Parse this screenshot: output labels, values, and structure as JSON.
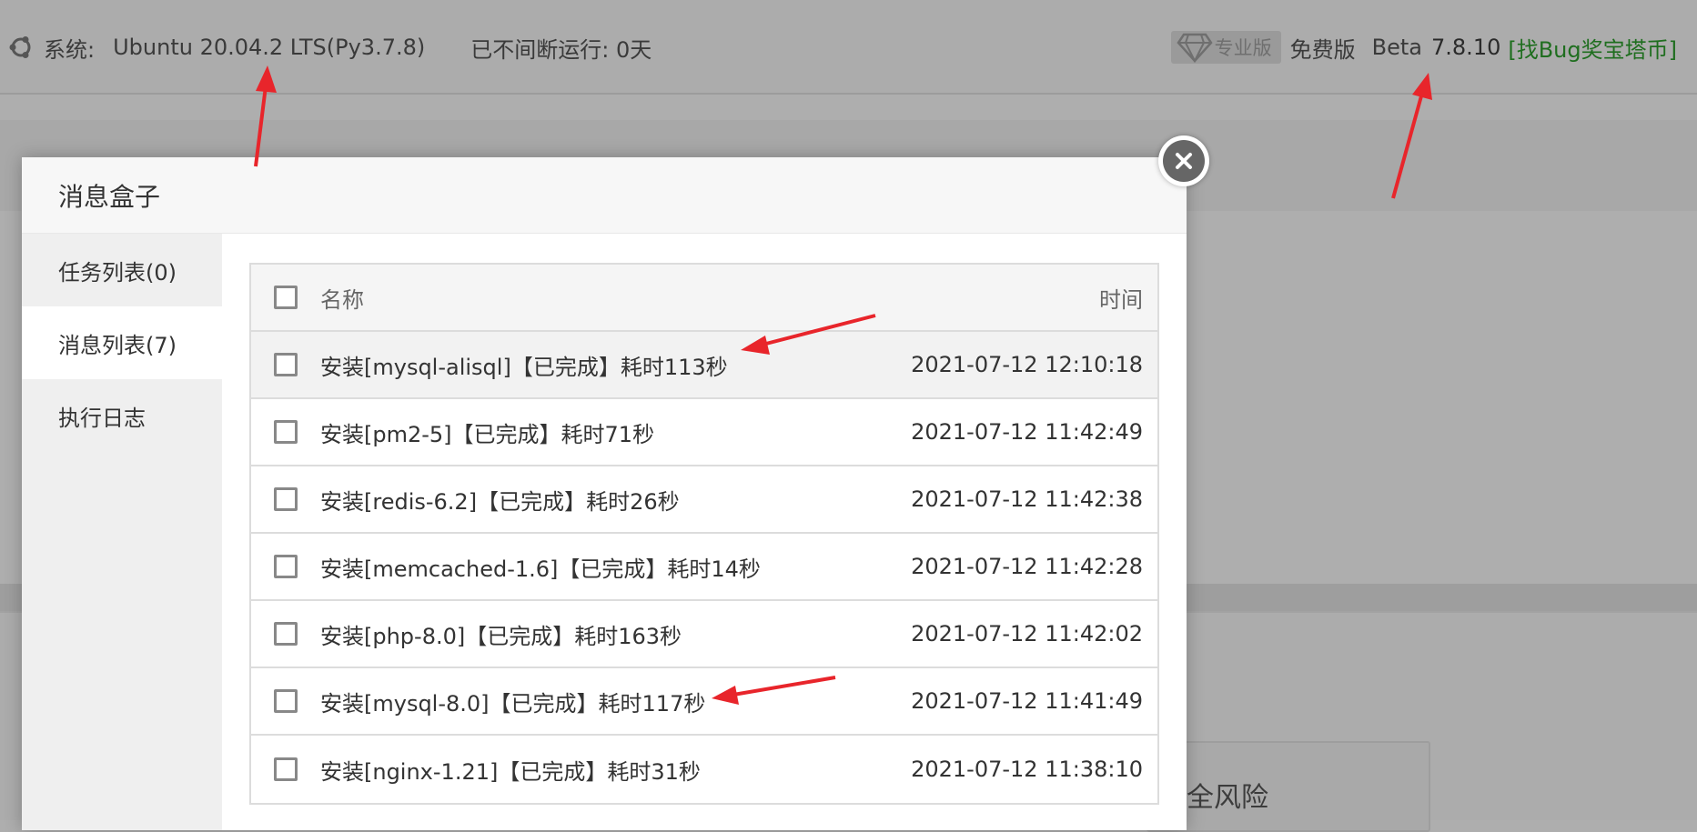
{
  "topbar": {
    "system_label": "系统:",
    "system_os": "Ubuntu 20.04.2 LTS(Py3.7.8)",
    "uptime": "已不间断运行: 0天",
    "pro_label": "专业版",
    "free_label": "免费版",
    "beta_label": "Beta",
    "version": "7.8.10",
    "bug_link": "[找Bug奖宝塔币]"
  },
  "background": {
    "card_text": "安全风险"
  },
  "modal": {
    "title": "消息盒子",
    "sidebar": [
      {
        "label": "任务列表(0)",
        "active": false
      },
      {
        "label": "消息列表(7)",
        "active": true
      },
      {
        "label": "执行日志",
        "active": false
      }
    ],
    "table": {
      "headers": {
        "name": "名称",
        "time": "时间"
      },
      "rows": [
        {
          "name": "安装[mysql-alisql]【已完成】耗时113秒",
          "time": "2021-07-12 12:10:18"
        },
        {
          "name": "安装[pm2-5]【已完成】耗时71秒",
          "time": "2021-07-12 11:42:49"
        },
        {
          "name": "安装[redis-6.2]【已完成】耗时26秒",
          "time": "2021-07-12 11:42:38"
        },
        {
          "name": "安装[memcached-1.6]【已完成】耗时14秒",
          "time": "2021-07-12 11:42:28"
        },
        {
          "name": "安装[php-8.0]【已完成】耗时163秒",
          "time": "2021-07-12 11:42:02"
        },
        {
          "name": "安装[mysql-8.0]【已完成】耗时117秒",
          "time": "2021-07-12 11:41:49"
        },
        {
          "name": "安装[nginx-1.21]【已完成】耗时31秒",
          "time": "2021-07-12 11:38:10"
        }
      ]
    }
  },
  "colors": {
    "bug_link": "#1f6e1f",
    "arrow": "#e8252b",
    "overlay": "#aeaeae"
  },
  "icons": [
    "ubuntu-icon",
    "gem-icon",
    "close-icon",
    "arrow-annotation"
  ]
}
